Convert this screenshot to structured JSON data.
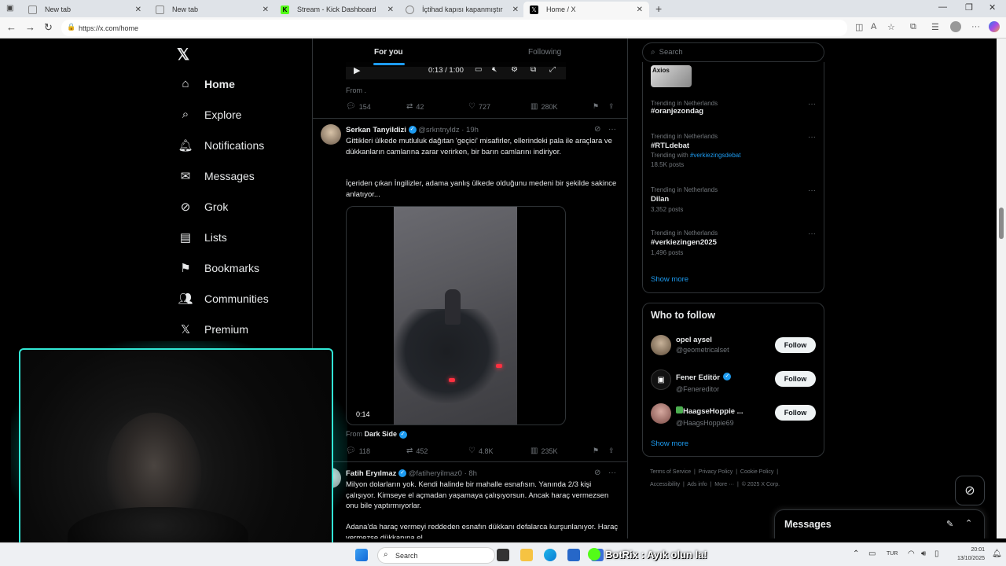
{
  "browser": {
    "tabs": [
      {
        "title": "New tab",
        "icon": "tab-page-icon"
      },
      {
        "title": "New tab",
        "icon": "tab-page-icon"
      },
      {
        "title": "Stream - Kick Dashboard",
        "icon": "kick-icon"
      },
      {
        "title": "İçtihad kapısı kapanmıştır",
        "icon": "globe-icon"
      },
      {
        "title": "Home / X",
        "icon": "x-icon"
      }
    ],
    "url": "https://x.com/home"
  },
  "nav": {
    "items": [
      {
        "label": "Home",
        "icon": "home-icon"
      },
      {
        "label": "Explore",
        "icon": "search-icon"
      },
      {
        "label": "Notifications",
        "icon": "bell-icon"
      },
      {
        "label": "Messages",
        "icon": "mail-icon"
      },
      {
        "label": "Grok",
        "icon": "grok-icon"
      },
      {
        "label": "Lists",
        "icon": "list-icon"
      },
      {
        "label": "Bookmarks",
        "icon": "bookmark-icon"
      },
      {
        "label": "Communities",
        "icon": "communities-icon"
      },
      {
        "label": "Premium",
        "icon": "x-icon"
      }
    ]
  },
  "feed": {
    "tabs": {
      "for_you": "For you",
      "following": "Following"
    },
    "video_time": "0:13 / 1:00",
    "prev_tweet": {
      "from": "From .",
      "replies": "154",
      "reposts": "42",
      "likes": "727",
      "views": "280K"
    },
    "tweet1": {
      "name": "Serkan Tanyildizi",
      "handle": "@srkntnyldz",
      "time": "· 19h",
      "text1": "Gittikleri ülkede mutluluk dağıtan 'geçici' misafirler, ellerindeki pala ile araçlara ve dükkanların camlarına zarar verirken, bir barın camlarını indiriyor.",
      "text2": "İçeriden çıkan İngilizler, adama yanlış ülkede olduğunu medeni bir şekilde sakince anlatıyor...",
      "video_duration": "0:14",
      "from_label": "From",
      "from_name": "Dark Side",
      "replies": "118",
      "reposts": "452",
      "likes": "4.8K",
      "views": "235K"
    },
    "tweet2": {
      "name": "Fatih Eryılmaz",
      "handle": "@fatiheryilmaz0",
      "time": "· 8h",
      "text1": "Milyon dolarların yok. Kendi halinde bir mahalle esnafısın. Yanında 2/3 kişi çalışıyor. Kimseye el açmadan yaşamaya çalışıyorsun. Ancak haraç vermezsen onu bile yaptırmıyorlar.",
      "text2": "Adana'da haraç vermeyi reddeden esnafın dükkanı defalarca kurşunlanıyor. Haraç vermezse dükkanına el..."
    }
  },
  "sidebar": {
    "search_placeholder": "Search",
    "axios_label": "Axios",
    "trends": [
      {
        "meta": "Trending in Netherlands",
        "tag": "#oranjezondag",
        "extra": "",
        "with": "",
        "posts": ""
      },
      {
        "meta": "Trending in Netherlands",
        "tag": "#RTLdebat",
        "extra": "Trending with",
        "with": "#verkiezingsdebat",
        "posts": "18.5K posts"
      },
      {
        "meta": "Trending in Netherlands",
        "tag": "Dilan",
        "extra": "",
        "with": "",
        "posts": "3,352 posts"
      },
      {
        "meta": "Trending in Netherlands",
        "tag": "#verkiezingen2025",
        "extra": "",
        "with": "",
        "posts": "1,496 posts"
      }
    ],
    "show_more": "Show more",
    "who_to_follow": {
      "title": "Who to follow",
      "users": [
        {
          "name": "opel aysel",
          "handle": "@geometricalset",
          "button": "Follow"
        },
        {
          "name": "Fener Editör",
          "handle": "@Fenereditor",
          "button": "Follow"
        },
        {
          "name": "HaagseHoppie ...",
          "handle": "@HaagsHoppie69",
          "button": "Follow"
        }
      ],
      "show_more": "Show more"
    },
    "footer": {
      "line1": [
        "Terms of Service",
        "Privacy Policy",
        "Cookie Policy"
      ],
      "line2": [
        "Accessibility",
        "Ads info",
        "More ···",
        "© 2025 X Corp."
      ]
    },
    "messages_label": "Messages"
  },
  "taskbar": {
    "search_label": "Search",
    "botrix_text": "BotRix : Ayık olun la!",
    "lang": "TUR",
    "time": "20:01",
    "date": "13/10/2025"
  },
  "colors": {
    "accent": "#1d9bf0",
    "webcam_glow": "#31e8d6",
    "background": "#000000"
  }
}
